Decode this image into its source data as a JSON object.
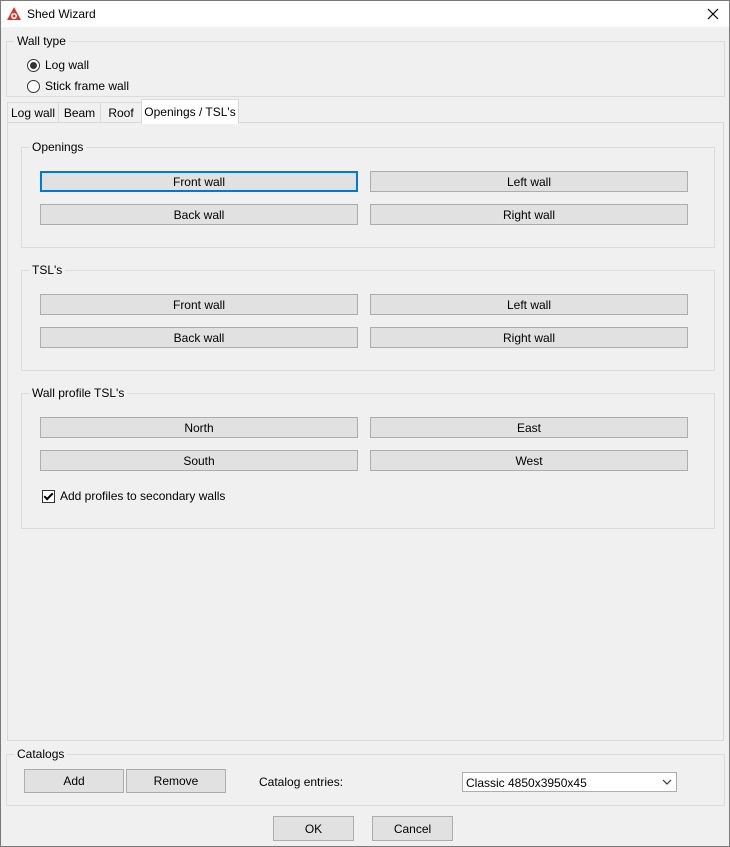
{
  "window": {
    "title": "Shed Wizard"
  },
  "wall_type": {
    "legend": "Wall type",
    "options": [
      {
        "label": "Log wall",
        "checked": true
      },
      {
        "label": "Stick frame wall",
        "checked": false
      }
    ]
  },
  "tabs": [
    {
      "label": "Log wall",
      "active": false
    },
    {
      "label": "Beam",
      "active": false
    },
    {
      "label": "Roof",
      "active": false
    },
    {
      "label": "Openings / TSL's",
      "active": true
    }
  ],
  "openings": {
    "legend": "Openings",
    "front": "Front wall",
    "left": "Left wall",
    "back": "Back wall",
    "right": "Right wall"
  },
  "tsls": {
    "legend": "TSL's",
    "front": "Front wall",
    "left": "Left wall",
    "back": "Back wall",
    "right": "Right wall"
  },
  "wall_profile": {
    "legend": "Wall profile TSL's",
    "north": "North",
    "east": "East",
    "south": "South",
    "west": "West",
    "secondary_label": "Add profiles to secondary walls",
    "secondary_checked": true
  },
  "catalogs": {
    "legend": "Catalogs",
    "add": "Add",
    "remove": "Remove",
    "entries_label": "Catalog entries:",
    "selected_entry": "Classic 4850x3950x45"
  },
  "footer": {
    "ok": "OK",
    "cancel": "Cancel"
  },
  "colors": {
    "focus": "#0078d7",
    "icon": "#d9342b"
  }
}
